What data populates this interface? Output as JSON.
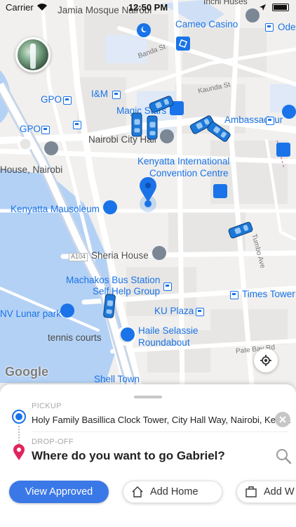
{
  "status_bar": {
    "carrier": "Carrier",
    "time": "12:50 PM"
  },
  "map": {
    "streets": [
      "Banda St",
      "Kaunda St",
      "Tumbo Ave",
      "Pate Bay Rd",
      "A104"
    ],
    "places": {
      "jamia": "Jamia Mosque Nairobi",
      "cameo": "Cameo Casino",
      "ode": "Ode",
      "gpo1": "GPO",
      "gpo2": "GPO",
      "im": "I&M",
      "magic": "Magic Stars",
      "ambassadeur": "Ambassadeur",
      "cityhall": "Nairobi City Hall",
      "house": "House, Nairobi",
      "kicc1": "Kenyatta International",
      "kicc2": "Convention Centre",
      "mausoleum": "Kenyatta Mausoleum",
      "sheria": "Sheria House",
      "machakos": "Machakos Bus Station",
      "selfhelp": "Self Help Group",
      "times": "Times Tower",
      "lunar": "NV Lunar park",
      "kuplaza": "KU Plaza",
      "haile1": "Haile Selassie",
      "haile2": "Roundabout",
      "tennis": "tennis courts",
      "shell": "Shell Town",
      "top": "Inchi Huses"
    },
    "google_logo": "Google",
    "colors": {
      "water": "#b3d1f5",
      "road": "#ffffff",
      "block": "#e6e5e3",
      "poi": "#1a73e8",
      "car": "#1c78d8"
    }
  },
  "sheet": {
    "pickup": {
      "label": "PICKUP",
      "value": "Holy Family Basillica Clock Tower, City Hall Way, Nairobi, Kenya"
    },
    "dropoff": {
      "label": "DROP-OFF",
      "value": "Where do you want to go Gabriel?"
    },
    "chips": [
      {
        "label": "View Approved",
        "icon": "none"
      },
      {
        "label": "Add Home",
        "icon": "home-icon"
      },
      {
        "label": "Add W",
        "icon": "briefcase-icon"
      }
    ]
  }
}
